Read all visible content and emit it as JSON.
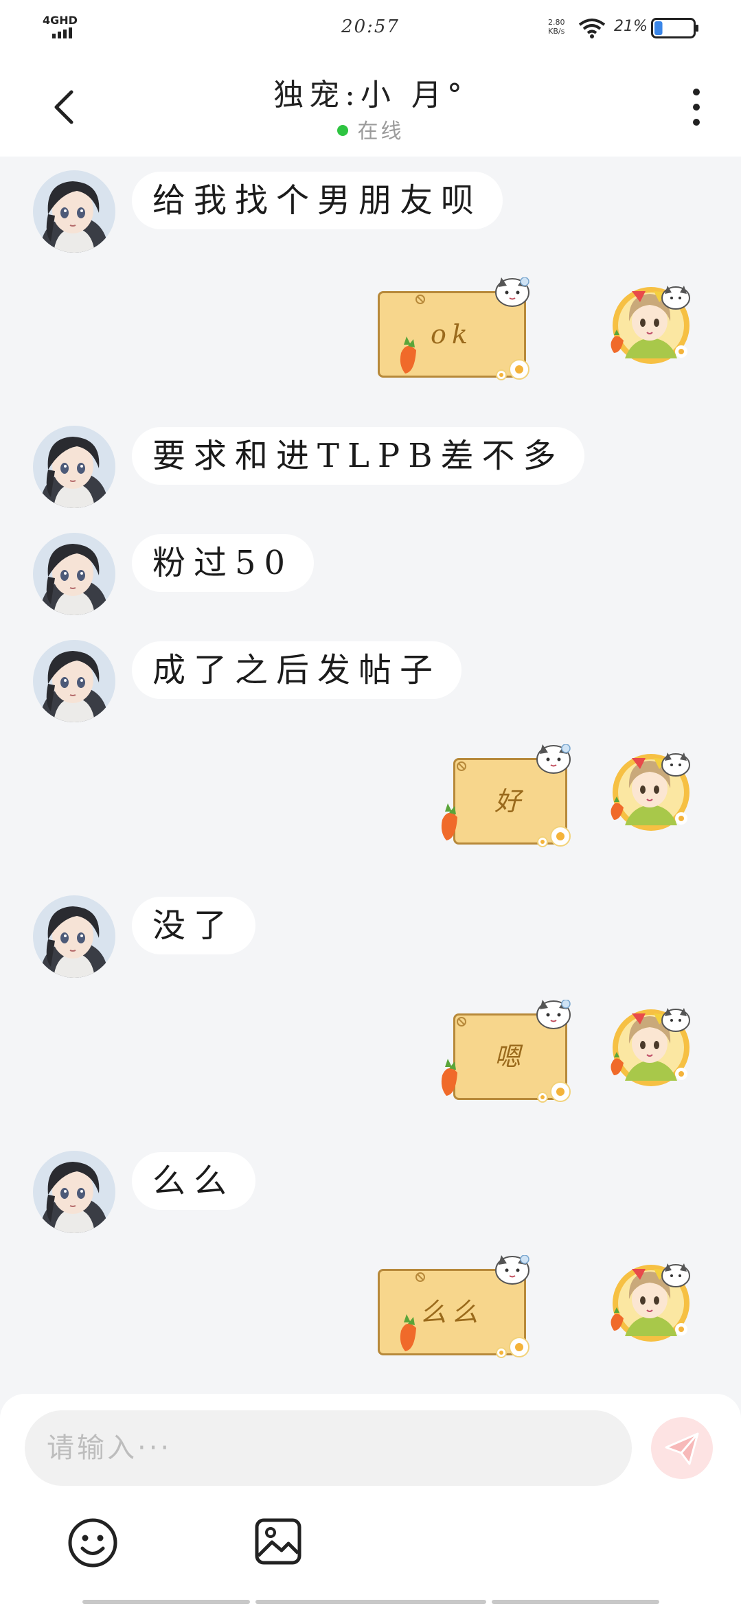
{
  "status_bar": {
    "network": "4GHD",
    "time": "20:57",
    "rate_value": "2.80",
    "rate_unit": "KB/s",
    "battery_pct": "21%",
    "battery_level": 0.21
  },
  "header": {
    "title": "独宠:小 月°",
    "status": "在线",
    "status_color": "#2ec441"
  },
  "messages": [
    {
      "side": "left",
      "type": "text",
      "text": "给我找个男朋友呗"
    },
    {
      "side": "right",
      "type": "sticker",
      "text": "ok"
    },
    {
      "side": "left",
      "type": "text",
      "text": "要求和进TLPB差不多"
    },
    {
      "side": "left",
      "type": "text",
      "text": "粉过50"
    },
    {
      "side": "left",
      "type": "text",
      "text": "成了之后发帖子"
    },
    {
      "side": "right",
      "type": "sticker",
      "text": "好"
    },
    {
      "side": "left",
      "type": "text",
      "text": "没了"
    },
    {
      "side": "right",
      "type": "sticker",
      "text": "嗯"
    },
    {
      "side": "left",
      "type": "text",
      "text": "么么"
    },
    {
      "side": "right",
      "type": "sticker",
      "text": "么么"
    }
  ],
  "composer": {
    "placeholder": "请输入···",
    "send_icon": "paper-plane-icon",
    "emoji_icon": "smiley-icon",
    "image_icon": "image-icon"
  },
  "colors": {
    "background": "#f4f5f7",
    "bubble": "#ffffff",
    "sticker_board": "#f7d68c",
    "send_button": "#fde3e3"
  }
}
